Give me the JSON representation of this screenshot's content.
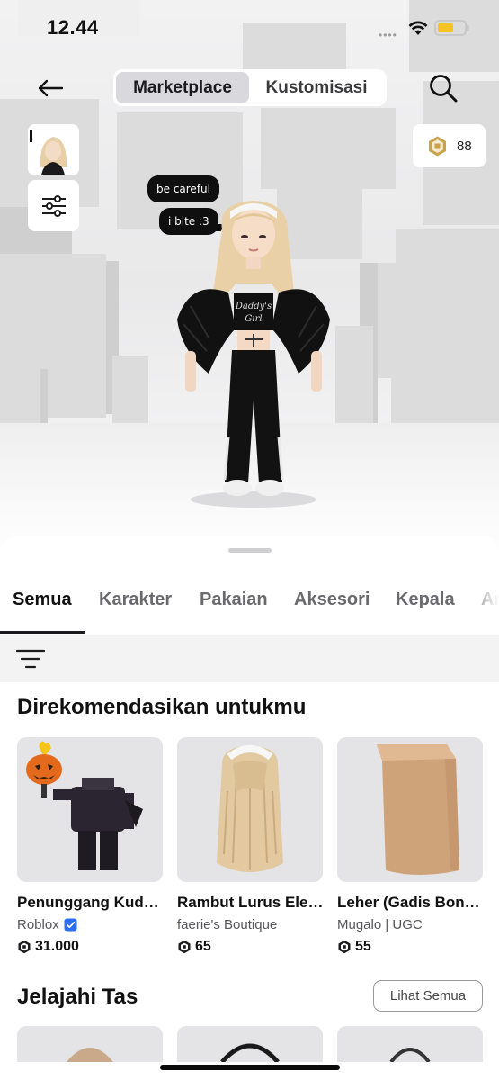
{
  "status_bar": {
    "time": "12.44",
    "signal": "••••"
  },
  "header": {
    "tabs": [
      {
        "label": "Marketplace",
        "active": true
      },
      {
        "label": "Kustomisasi",
        "active": false
      }
    ]
  },
  "robux": {
    "balance": "88"
  },
  "chat_bubbles": [
    "be careful",
    "i bite :3"
  ],
  "avatar_shirt_text": "Daddy's Girl",
  "category_tabs": [
    "Semua",
    "Karakter",
    "Pakaian",
    "Aksesori",
    "Kepala",
    "Ar"
  ],
  "recommended": {
    "title": "Direkomendasikan untukmu",
    "items": [
      {
        "name": "Penunggang Kud…",
        "creator": "Roblox",
        "verified": true,
        "price": "31.000"
      },
      {
        "name": "Rambut Lurus Ele…",
        "creator": "faerie's Boutique",
        "verified": false,
        "price": "65"
      },
      {
        "name": "Leher (Gadis Bon…",
        "creator": "Mugalo | UGC",
        "verified": false,
        "price": "55"
      }
    ]
  },
  "bags": {
    "title": "Jelajahi Tas",
    "see_all": "Lihat Semua"
  },
  "colors": {
    "accent_verified": "#2b6ef2",
    "robux_gold": "#c9a24a",
    "battery": "#f7c324"
  }
}
